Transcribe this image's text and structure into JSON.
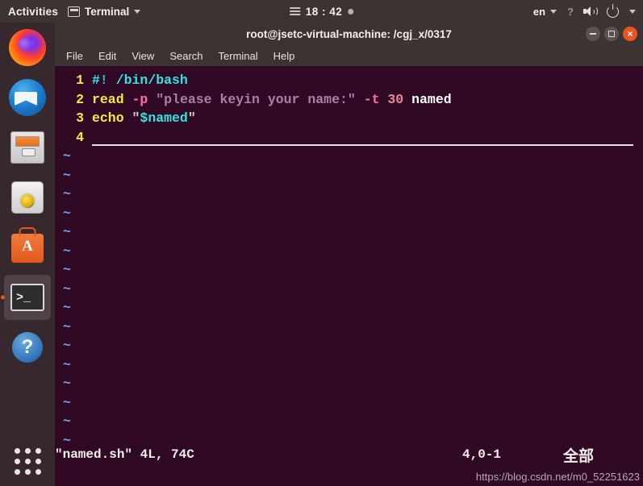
{
  "top_panel": {
    "activities_label": "Activities",
    "app_icon": "terminal-icon",
    "app_name": "Terminal",
    "app_caret": "chevron-down-icon",
    "calendar_icon": "calendar-lines-icon",
    "clock": "18 : 42",
    "notification_dot": "notification-dot",
    "language": "en",
    "language_caret": "chevron-down-icon",
    "accessibility_icon": "accessibility-icon",
    "volume_icon": "volume-icon",
    "power_icon": "power-icon",
    "system_caret": "chevron-down-icon"
  },
  "dock": {
    "items": [
      {
        "name": "firefox",
        "label": "Firefox",
        "active": false
      },
      {
        "name": "thunderbird",
        "label": "Thunderbird Mail",
        "active": false
      },
      {
        "name": "files",
        "label": "Files",
        "active": false
      },
      {
        "name": "rhythmbox",
        "label": "Rhythmbox",
        "active": false
      },
      {
        "name": "ubuntu-software",
        "label": "Ubuntu Software",
        "active": false
      },
      {
        "name": "terminal",
        "label": "Terminal",
        "active": true
      },
      {
        "name": "help",
        "label": "Help",
        "active": false
      }
    ],
    "app_grid_label": "Show Applications",
    "terminal_glyph": ">_",
    "help_glyph": "?",
    "software_glyph": "A"
  },
  "window": {
    "title": "root@jsetc-virtual-machine: /cgj_x/0317",
    "minimize_label": "minimize",
    "maximize_label": "maximize",
    "close_label": "close",
    "close_glyph": "×"
  },
  "menubar": {
    "items": [
      "File",
      "Edit",
      "View",
      "Search",
      "Terminal",
      "Help"
    ]
  },
  "editor": {
    "lines": [
      {
        "number": "1",
        "tokens": [
          {
            "text": "#",
            "cls": "c-shebang"
          },
          {
            "text": "!",
            "cls": "c-bang"
          },
          {
            "text": " /bin/bash",
            "cls": "c-shebang"
          }
        ]
      },
      {
        "number": "2",
        "tokens": [
          {
            "text": "read",
            "cls": "c-kw"
          },
          {
            "text": " ",
            "cls": "c-plain"
          },
          {
            "text": "-p",
            "cls": "c-opt"
          },
          {
            "text": " ",
            "cls": "c-plain"
          },
          {
            "text": "\"please keyin your name:\"",
            "cls": "c-str"
          },
          {
            "text": " ",
            "cls": "c-plain"
          },
          {
            "text": "-t",
            "cls": "c-opt"
          },
          {
            "text": " ",
            "cls": "c-plain"
          },
          {
            "text": "30",
            "cls": "c-num"
          },
          {
            "text": " ",
            "cls": "c-plain"
          },
          {
            "text": "named",
            "cls": "c-plain"
          }
        ]
      },
      {
        "number": "3",
        "tokens": [
          {
            "text": "echo",
            "cls": "c-kw"
          },
          {
            "text": " ",
            "cls": "c-plain"
          },
          {
            "text": "\"",
            "cls": "c-quote"
          },
          {
            "text": "$named",
            "cls": "c-var"
          },
          {
            "text": "\"",
            "cls": "c-quote"
          }
        ]
      },
      {
        "number": "4",
        "tokens": []
      }
    ],
    "empty_marker": "~",
    "empty_marker_count": 16
  },
  "status_line": {
    "file_info": "\"named.sh\" 4L, 74C",
    "position": "4,0-1",
    "scroll_percent": "全部"
  },
  "watermark": "https://blog.csdn.net/m0_52251623",
  "colors": {
    "panel_bg": "#3b3433",
    "dock_bg": "#36282c",
    "terminal_bg": "#300a24",
    "accent": "#e95420",
    "line_number": "#f5e942",
    "tilde": "#7a9ee8"
  }
}
